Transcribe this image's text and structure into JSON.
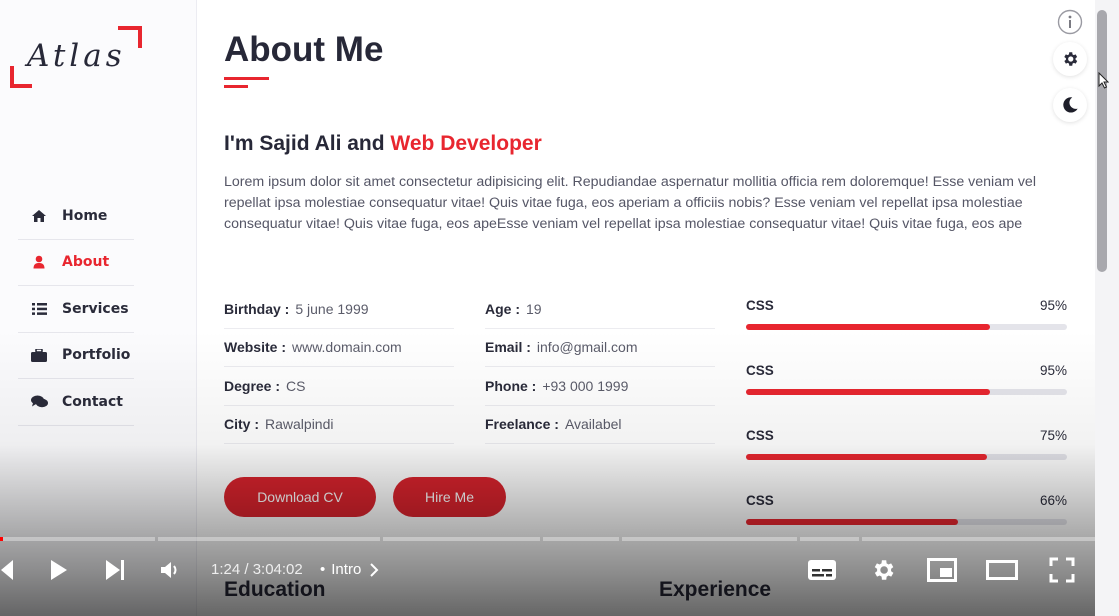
{
  "brand": {
    "logo_text": "Atlas"
  },
  "nav": {
    "items": [
      {
        "label": "Home",
        "icon": "home-icon"
      },
      {
        "label": "About",
        "icon": "user-icon",
        "active": true
      },
      {
        "label": "Services",
        "icon": "list-icon"
      },
      {
        "label": "Portfolio",
        "icon": "briefcase-icon"
      },
      {
        "label": "Contact",
        "icon": "comments-icon"
      }
    ]
  },
  "about": {
    "title": "About Me",
    "intro_prefix": "I'm Sajid Ali and ",
    "intro_role": "Web Developer",
    "paragraph": "Lorem ipsum dolor sit amet consectetur adipisicing elit. Repudiandae aspernatur mollitia officia rem doloremque! Esse veniam vel repellat ipsa molestiae consequatur vitae! Quis vitae fuga, eos aperiam a officiis nobis? Esse veniam vel repellat ipsa molestiae consequatur vitae! Quis vitae fuga, eos apeEsse veniam vel repellat ipsa molestiae consequatur vitae! Quis vitae fuga, eos ape",
    "info_left": [
      {
        "label": "Birthday :",
        "value": "5 june 1999"
      },
      {
        "label": "Website :",
        "value": "www.domain.com"
      },
      {
        "label": "Degree :",
        "value": "CS"
      },
      {
        "label": "City :",
        "value": "Rawalpindi"
      }
    ],
    "info_right": [
      {
        "label": "Age :",
        "value": "19"
      },
      {
        "label": "Email :",
        "value": "info@gmail.com"
      },
      {
        "label": "Phone :",
        "value": "+93 000 1999"
      },
      {
        "label": "Freelance :",
        "value": "Availabel"
      }
    ],
    "buttons": {
      "download_cv": "Download CV",
      "hire_me": "Hire Me"
    },
    "skills": [
      {
        "name": "CSS",
        "percent_label": "95%",
        "level": 0.76
      },
      {
        "name": "CSS",
        "percent_label": "95%",
        "level": 0.76
      },
      {
        "name": "CSS",
        "percent_label": "75%",
        "level": 0.75
      },
      {
        "name": "CSS",
        "percent_label": "66%",
        "level": 0.66
      }
    ],
    "next_sections": {
      "education": "Education",
      "experience": "Experience"
    }
  },
  "floating_buttons": {
    "info": "info-icon",
    "settings": "gear-icon",
    "theme": "moon-icon"
  },
  "video_player": {
    "time": "1:24 / 3:04:02",
    "chapter": "Intro",
    "played_fraction": 0.003,
    "accent": "#ff0000"
  },
  "colors": {
    "accent": "#e8262f",
    "text": "#272838",
    "muted": "#555666"
  }
}
